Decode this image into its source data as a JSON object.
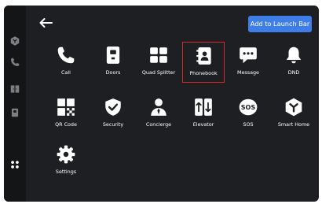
{
  "header": {
    "launch_bar_button_label": "Add to Launch Bar"
  },
  "sidebar": {
    "items": [
      {
        "name": "sidebar-item-homekit",
        "icon": "hexagon-icon"
      },
      {
        "name": "sidebar-item-call",
        "icon": "phone-icon"
      },
      {
        "name": "sidebar-item-doors",
        "icon": "door-icon"
      },
      {
        "name": "sidebar-item-device",
        "icon": "square-icon"
      },
      {
        "name": "sidebar-item-apps",
        "icon": "apps-grid-icon",
        "active": true
      }
    ]
  },
  "apps": [
    {
      "label": "Call",
      "icon": "phone-icon"
    },
    {
      "label": "Doors",
      "icon": "door-icon"
    },
    {
      "label": "Quad Splitter",
      "icon": "quad-grid-icon"
    },
    {
      "label": "Phonebook",
      "icon": "phonebook-icon",
      "selected": true
    },
    {
      "label": "Message",
      "icon": "message-icon"
    },
    {
      "label": "DND",
      "icon": "bell-icon"
    },
    {
      "label": "QR Code",
      "icon": "qr-code-icon"
    },
    {
      "label": "Security",
      "icon": "shield-check-icon"
    },
    {
      "label": "Concierge",
      "icon": "concierge-icon"
    },
    {
      "label": "Elevator",
      "icon": "elevator-icon"
    },
    {
      "label": "SOS",
      "icon": "sos-icon"
    },
    {
      "label": "Smart Home",
      "icon": "smart-home-icon"
    },
    {
      "label": "Settings",
      "icon": "gear-icon"
    }
  ],
  "colors": {
    "background": "#1d1f22",
    "sidebar": "#141517",
    "accent": "#3f7ee8",
    "selection": "#d9272e",
    "icon": "#ffffff"
  }
}
